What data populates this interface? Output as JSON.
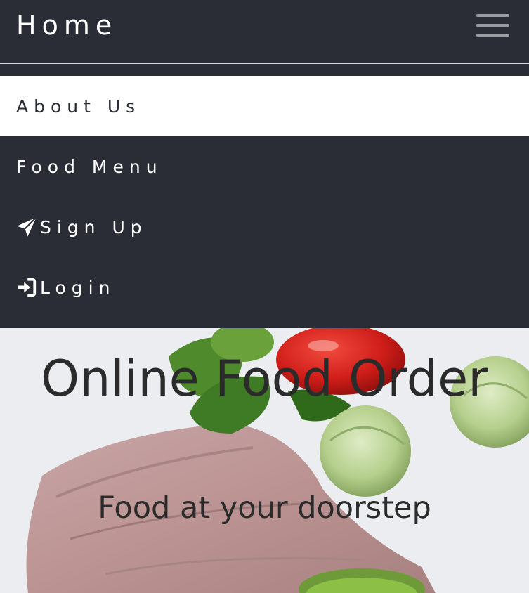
{
  "navbar": {
    "brand": "Home",
    "toggler_icon": "hamburger-icon"
  },
  "menu": {
    "items": [
      {
        "label": "About Us",
        "active": true
      },
      {
        "label": "Food Menu"
      },
      {
        "label": "Sign Up",
        "icon": "paper-plane-icon"
      },
      {
        "label": "Login",
        "icon": "sign-in-icon"
      }
    ]
  },
  "hero": {
    "title": "Online Food Order",
    "subtitle": "Food at your doorstep"
  },
  "colors": {
    "nav_background": "#2a2d36",
    "active_item_background": "#ffffff",
    "nav_text": "#ffffff",
    "hero_text": "#2b2b2b"
  }
}
